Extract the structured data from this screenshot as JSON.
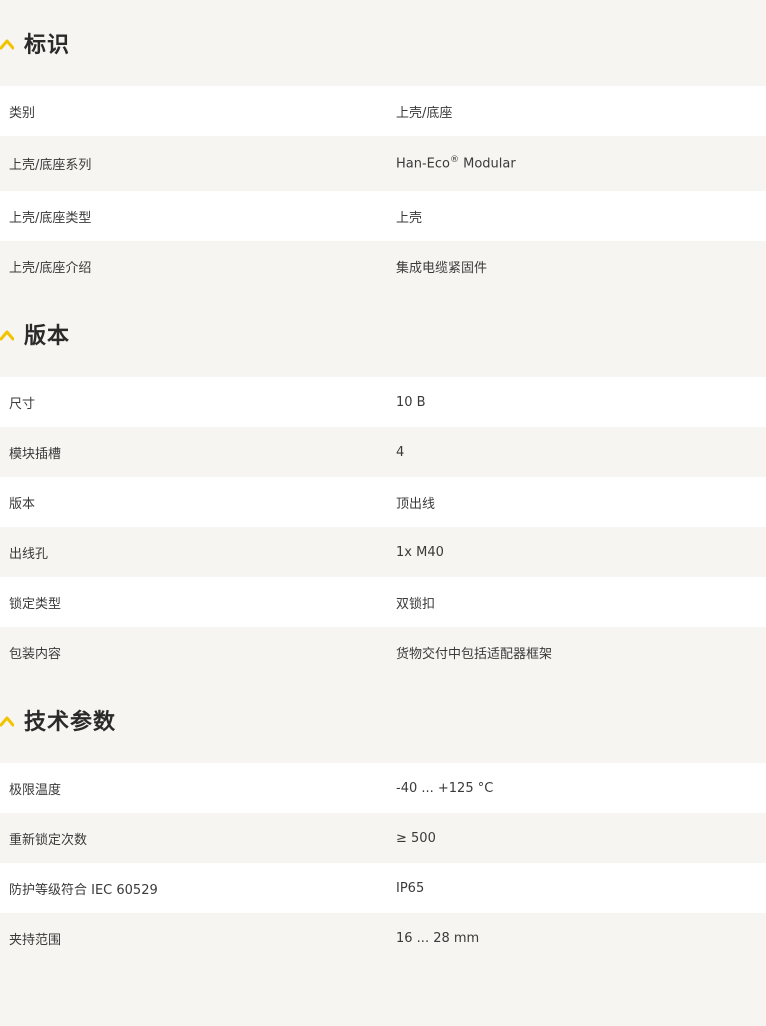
{
  "sections": [
    {
      "title": "标识",
      "rows": [
        {
          "label": "类别",
          "value": "上壳/底座"
        },
        {
          "label": "上壳/底座系列",
          "value": "Han-Eco",
          "value_sup": "®",
          "value_suffix": " Modular"
        },
        {
          "label": "上壳/底座类型",
          "value": "上壳"
        },
        {
          "label": "上壳/底座介绍",
          "value": "集成电缆紧固件"
        }
      ]
    },
    {
      "title": "版本",
      "rows": [
        {
          "label": "尺寸",
          "value": "10 B"
        },
        {
          "label": "模块插槽",
          "value": "4"
        },
        {
          "label": "版本",
          "value": "顶出线"
        },
        {
          "label": "出线孔",
          "value": "1x M40"
        },
        {
          "label": "锁定类型",
          "value": "双锁扣"
        },
        {
          "label": "包装内容",
          "value": "货物交付中包括适配器框架"
        }
      ]
    },
    {
      "title": "技术参数",
      "rows": [
        {
          "label": "极限温度",
          "value": "-40 ... +125 °C"
        },
        {
          "label": "重新锁定次数",
          "value": "≥ 500"
        },
        {
          "label": "防护等级符合 IEC 60529",
          "value": "IP65"
        },
        {
          "label": "夹持范围",
          "value": "16 ... 28 mm"
        }
      ]
    }
  ],
  "colors": {
    "accent_chevron": "#f2c400",
    "row_white": "#ffffff",
    "row_gray": "#f6f5f1"
  },
  "icons": {
    "section_toggle": "chevron-up-icon"
  }
}
